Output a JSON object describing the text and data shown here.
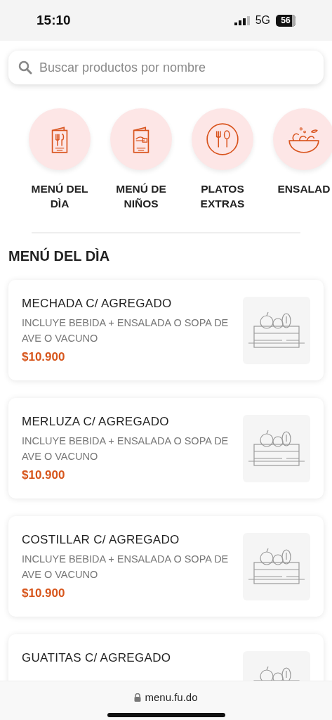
{
  "status_bar": {
    "time": "15:10",
    "network": "5G",
    "battery": "56"
  },
  "search": {
    "placeholder": "Buscar productos por nombre"
  },
  "categories": [
    {
      "label": "MENÚ DEL DÌA"
    },
    {
      "label": "MENÚ DE NIÑOS"
    },
    {
      "label": "PLATOS EXTRAS"
    },
    {
      "label": "ENSALAD"
    }
  ],
  "section_title": "MENÚ DEL DÌA",
  "products": [
    {
      "name": "MECHADA C/ AGREGADO",
      "description": "INCLUYE BEBIDA + ENSALADA O SOPA DE AVE O VACUNO",
      "price": "$10.900"
    },
    {
      "name": "MERLUZA C/ AGREGADO",
      "description": "INCLUYE BEBIDA + ENSALADA O SOPA DE AVE O VACUNO",
      "price": "$10.900"
    },
    {
      "name": "COSTILLAR C/ AGREGADO",
      "description": "INCLUYE BEBIDA + ENSALADA O SOPA DE AVE O VACUNO",
      "price": "$10.900"
    },
    {
      "name": "GUATITAS C/ AGREGADO"
    }
  ],
  "browser_bar": {
    "url": "menu.fu.do"
  }
}
